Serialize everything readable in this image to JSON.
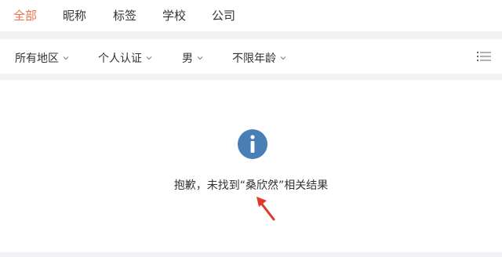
{
  "tabs": [
    {
      "label": "全部",
      "active": true
    },
    {
      "label": "昵称",
      "active": false
    },
    {
      "label": "标签",
      "active": false
    },
    {
      "label": "学校",
      "active": false
    },
    {
      "label": "公司",
      "active": false
    }
  ],
  "filters": {
    "region": "所有地区",
    "verification": "个人认证",
    "gender": "男",
    "age": "不限年龄"
  },
  "icons": {
    "filter_chevron": "chevron-down-icon",
    "view_toggle": "list-icon",
    "empty_state": "info-icon",
    "annotation": "arrow-annotation-icon"
  },
  "empty_state": {
    "message": "抱歉，未找到“桑欣然”相关结果"
  },
  "colors": {
    "active_tab": "#eb7350",
    "info_icon": "#4a7fb5",
    "annotation_arrow": "#e0392b",
    "page_bg": "#f2f2f5"
  }
}
